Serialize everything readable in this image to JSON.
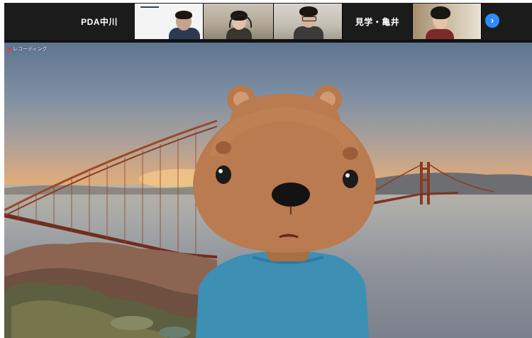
{
  "participants": [
    {
      "name": "PDA中川",
      "video": false
    },
    {
      "name": "",
      "video": true
    },
    {
      "name": "",
      "video": true
    },
    {
      "name": "",
      "video": true
    },
    {
      "name": "見学・亀井",
      "video": false
    },
    {
      "name": "",
      "video": true
    }
  ],
  "next_page_icon": "chevron-right-icon",
  "recording_label": "レコーディング",
  "colors": {
    "accent": "#2d8cff",
    "recording": "#e23b3b",
    "strip_bg": "#1b1b1b"
  }
}
